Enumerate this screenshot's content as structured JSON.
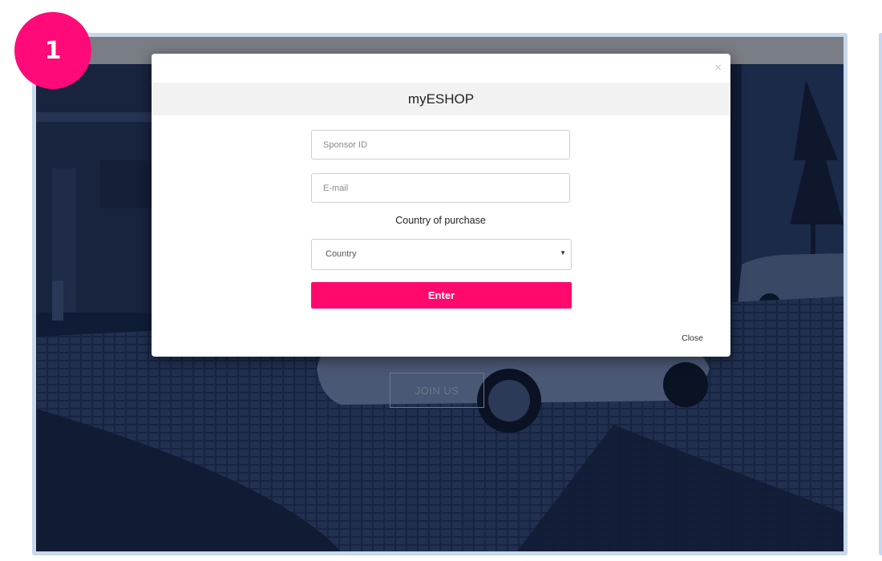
{
  "step_badge": "1",
  "modal": {
    "close_icon": "×",
    "title": "myESHOP",
    "sponsor_id_placeholder": "Sponsor ID",
    "email_placeholder": "E-mail",
    "country_label": "Country of purchase",
    "country_select_value": "Country",
    "enter_label": "Enter",
    "close_label": "Close"
  },
  "background": {
    "join_us_label": "JOIN US"
  },
  "colors": {
    "accent": "#ff0a6c",
    "badge": "#ff0a78",
    "overlay": "#0e1a33"
  },
  "icons": {
    "close": "close-icon",
    "dropdown": "caret-down-icon"
  }
}
